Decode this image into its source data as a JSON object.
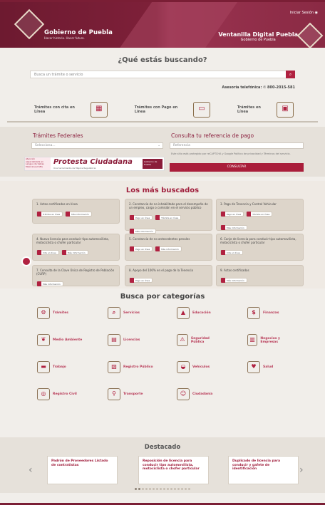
{
  "header": {
    "left_title": "Gobierno de Puebla",
    "left_sub": "Hacer historia. Hacer futuro.",
    "right_title": "Ventanilla Digital Puebla",
    "right_sub": "Gobierno de Puebla",
    "login": "Iniciar Sesión"
  },
  "search": {
    "question": "¿Qué estás buscando?",
    "placeholder": "Busca un trámite o servicio",
    "phone": "Asesoría telefónica: ✆ 800-2015-581"
  },
  "quick_links": [
    {
      "label": "Trámites con cita en Línea",
      "icon": "calendar-icon",
      "glyph": "▦"
    },
    {
      "label": "Trámites con Pago en Línea",
      "icon": "card-icon",
      "glyph": "▭"
    },
    {
      "label": "Trámites en Línea",
      "icon": "browser-icon",
      "glyph": "▣"
    }
  ],
  "tramites": {
    "federales_title": "Trámites Federales",
    "select_value": "Selecciona...",
    "ref_title": "Consulta tu referencia de pago",
    "ref_placeholder": "Referencia",
    "captcha": "Este sitio está protegido por reCAPTCHA y Google Política de privacidad y Términos del servicio.",
    "button": "CONSULTAR",
    "banner": {
      "left": "Atención especializada en Lengua de Señas Mexicana (LSM)",
      "main": "Protesta Ciudadana",
      "sub": "Una herramienta de Mejora Regulatoria",
      "right": "Gobierno de Puebla"
    }
  },
  "most": {
    "title": "Los más buscados",
    "cards": [
      {
        "title": "1. Actas certificadas en línea",
        "pills": [
          "Trámite en línea",
          "Más información"
        ]
      },
      {
        "title": "2. Constancia de no inhabilitado para el desempeño de un empleo, cargo o comisión en el servicio público",
        "pills": [
          "Pago en línea",
          "Trámite en línea",
          "Más información"
        ]
      },
      {
        "title": "3. Pago de Tenencia y Control Vehicular",
        "pills": [
          "Pago en línea",
          "Trámite en línea",
          "Más información"
        ]
      },
      {
        "title": "4. Nueva licencia para conducir tipo automovilista, motociclista o chofer particular",
        "pills": [
          "Cita en línea",
          "Más información"
        ]
      },
      {
        "title": "5. Constancia de no antecedentes penales",
        "pills": [
          "Pago en línea",
          "Más información"
        ]
      },
      {
        "title": "6. Canje de licencia para conducir tipo automovilista, motociclista o chofer particular",
        "pills": [
          "Cita en línea"
        ]
      },
      {
        "title": "7. Consulta de la Clave Única de Registro de Población (CURP)",
        "pills": [
          "Más información"
        ]
      },
      {
        "title": "8. Apoyo del 100% en el pago de la Tenencia",
        "pills": [
          "Pago en línea"
        ]
      },
      {
        "title": "9. Actas certificadas",
        "pills": [
          "Más información"
        ]
      }
    ]
  },
  "categories": {
    "title": "Busca por categorías",
    "items": [
      {
        "label": "Trámites",
        "icon": "gear-doc-icon",
        "glyph": "⚙"
      },
      {
        "label": "Servicios",
        "icon": "search-doc-icon",
        "glyph": "⌕"
      },
      {
        "label": "Educación",
        "icon": "graduation-cap-icon",
        "glyph": "▲"
      },
      {
        "label": "Finanzas",
        "icon": "money-icon",
        "glyph": "$"
      },
      {
        "label": "Medio Ambiente",
        "icon": "leaf-icon",
        "glyph": "❦"
      },
      {
        "label": "Licencias",
        "icon": "id-card-icon",
        "glyph": "▤"
      },
      {
        "label": "Seguridad Pública",
        "icon": "siren-icon",
        "glyph": "⚠"
      },
      {
        "label": "Negocios y Empresas",
        "icon": "business-doc-icon",
        "glyph": "▥"
      },
      {
        "label": "Trabajo",
        "icon": "briefcase-icon",
        "glyph": "▬"
      },
      {
        "label": "Registro Público",
        "icon": "registry-icon",
        "glyph": "▧"
      },
      {
        "label": "Vehículos",
        "icon": "car-icon",
        "glyph": "◒"
      },
      {
        "label": "Salud",
        "icon": "heartbeat-icon",
        "glyph": "♥"
      },
      {
        "label": "Registro Civil",
        "icon": "fingerprint-icon",
        "glyph": "◎"
      },
      {
        "label": "Transporte",
        "icon": "bus-stop-icon",
        "glyph": "⚲"
      },
      {
        "label": "Ciudadanía",
        "icon": "family-icon",
        "glyph": "☺"
      }
    ]
  },
  "destacado": {
    "title": "Destacado",
    "slides": [
      "Padrón de Proveedores Listado de contratistas",
      "Reposición de licencia para conducir tipo automovilista, motociclista o chofer particular",
      "Duplicado de licencia para conducir y gafete de identificación"
    ]
  }
}
